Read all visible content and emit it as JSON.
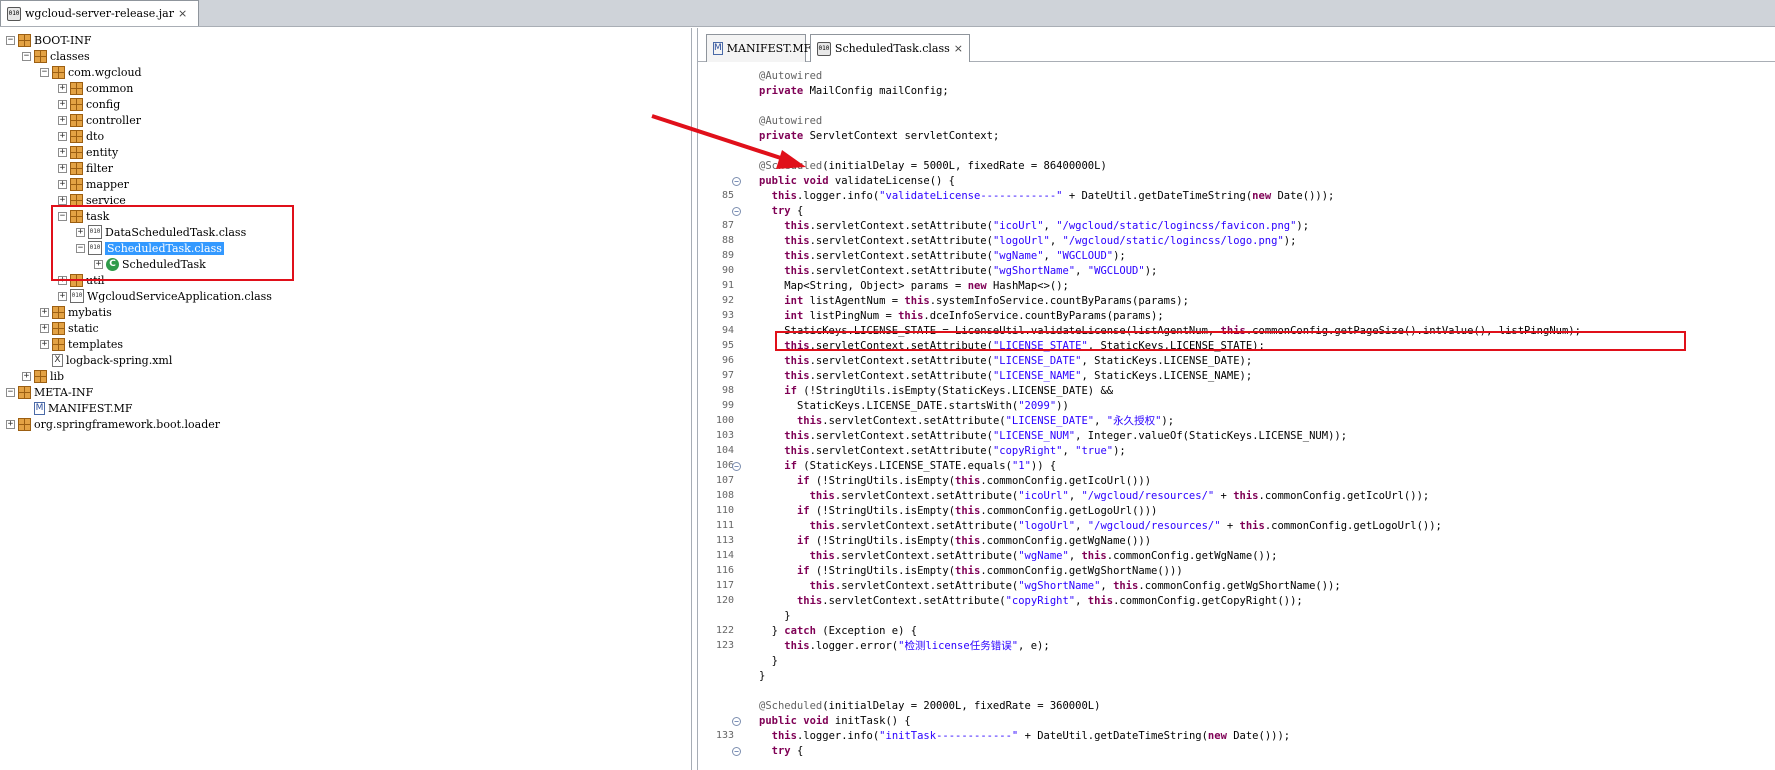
{
  "left_tab": {
    "title": "wgcloud-server-release.jar",
    "close": "⨯"
  },
  "tree": [
    {
      "id": "boot-inf",
      "label": "BOOT-INF",
      "icon": "package-icon",
      "toggle": "−"
    },
    {
      "id": "classes",
      "label": "classes",
      "icon": "package-icon",
      "toggle": "−"
    },
    {
      "id": "com-wgcloud",
      "label": "com.wgcloud",
      "icon": "package-icon",
      "toggle": "−"
    },
    {
      "id": "common",
      "label": "common",
      "icon": "package-icon",
      "toggle": "+"
    },
    {
      "id": "config",
      "label": "config",
      "icon": "package-icon",
      "toggle": "+"
    },
    {
      "id": "controller",
      "label": "controller",
      "icon": "package-icon",
      "toggle": "+"
    },
    {
      "id": "dto",
      "label": "dto",
      "icon": "package-icon",
      "toggle": "+"
    },
    {
      "id": "entity",
      "label": "entity",
      "icon": "package-icon",
      "toggle": "+"
    },
    {
      "id": "filter",
      "label": "filter",
      "icon": "package-icon",
      "toggle": "+"
    },
    {
      "id": "mapper",
      "label": "mapper",
      "icon": "package-icon",
      "toggle": "+"
    },
    {
      "id": "service",
      "label": "service",
      "icon": "package-icon",
      "toggle": "+"
    },
    {
      "id": "task",
      "label": "task",
      "icon": "package-icon",
      "toggle": "−"
    },
    {
      "id": "data-scheduled-task",
      "label": "DataScheduledTask.class",
      "icon": "class-file-icon",
      "toggle": "+"
    },
    {
      "id": "scheduled-task-class",
      "label": "ScheduledTask.class",
      "icon": "class-file-icon",
      "toggle": "−",
      "selected": true
    },
    {
      "id": "scheduled-task",
      "label": "ScheduledTask",
      "icon": "class-icon",
      "toggle": "+"
    },
    {
      "id": "util",
      "label": "util",
      "icon": "package-icon",
      "toggle": "+"
    },
    {
      "id": "wgcloud-service-app",
      "label": "WgcloudServiceApplication.class",
      "icon": "class-file-icon",
      "toggle": "+"
    },
    {
      "id": "mybatis",
      "label": "mybatis",
      "icon": "package-icon",
      "toggle": "+"
    },
    {
      "id": "static",
      "label": "static",
      "icon": "package-icon",
      "toggle": "+"
    },
    {
      "id": "templates",
      "label": "templates",
      "icon": "package-icon",
      "toggle": "+"
    },
    {
      "id": "logback-spring",
      "label": "logback-spring.xml",
      "icon": "xml-file-icon",
      "toggle": ""
    },
    {
      "id": "lib",
      "label": "lib",
      "icon": "package-icon",
      "toggle": "+"
    },
    {
      "id": "meta-inf",
      "label": "META-INF",
      "icon": "package-icon",
      "toggle": "−"
    },
    {
      "id": "manifest-file",
      "label": "MANIFEST.MF",
      "icon": "manifest-file-icon",
      "toggle": ""
    },
    {
      "id": "spring-loader",
      "label": "org.springframework.boot.loader",
      "icon": "package-icon",
      "toggle": "+"
    }
  ],
  "editor_tabs": [
    {
      "title": "MANIFEST.MF",
      "close": "⨯"
    },
    {
      "title": "ScheduledTask.class",
      "close": "⨯",
      "active": true
    }
  ],
  "code_lines": [
    {
      "ln": "",
      "fold": "",
      "code": "@Autowired"
    },
    {
      "ln": "",
      "fold": "",
      "code": "private MailConfig mailConfig;"
    },
    {
      "ln": "",
      "fold": "",
      "code": ""
    },
    {
      "ln": "",
      "fold": "",
      "code": "@Autowired"
    },
    {
      "ln": "",
      "fold": "",
      "code": "private ServletContext servletContext;"
    },
    {
      "ln": "",
      "fold": "",
      "code": ""
    },
    {
      "ln": "",
      "fold": "",
      "code": "@Scheduled(initialDelay = 5000L, fixedRate = 86400000L)"
    },
    {
      "ln": "",
      "fold": "−",
      "code": "public void validateLicense() {"
    },
    {
      "ln": "85",
      "fold": "",
      "code": "  this.logger.info(\"validateLicense------------\" + DateUtil.getDateTimeString(new Date()));"
    },
    {
      "ln": "",
      "fold": "−",
      "code": "  try {"
    },
    {
      "ln": "87",
      "fold": "",
      "code": "    this.servletContext.setAttribute(\"icoUrl\", \"/wgcloud/static/logincss/favicon.png\");"
    },
    {
      "ln": "88",
      "fold": "",
      "code": "    this.servletContext.setAttribute(\"logoUrl\", \"/wgcloud/static/logincss/logo.png\");"
    },
    {
      "ln": "89",
      "fold": "",
      "code": "    this.servletContext.setAttribute(\"wgName\", \"WGCLOUD\");"
    },
    {
      "ln": "90",
      "fold": "",
      "code": "    this.servletContext.setAttribute(\"wgShortName\", \"WGCLOUD\");"
    },
    {
      "ln": "91",
      "fold": "",
      "code": "    Map<String, Object> params = new HashMap<>();"
    },
    {
      "ln": "92",
      "fold": "",
      "code": "    int listAgentNum = this.systemInfoService.countByParams(params);"
    },
    {
      "ln": "93",
      "fold": "",
      "code": "    int listPingNum = this.dceInfoService.countByParams(params);"
    },
    {
      "ln": "94",
      "fold": "",
      "code": "    StaticKeys.LICENSE_STATE = LicenseUtil.validateLicense(listAgentNum, this.commonConfig.getPageSize().intValue(), listPingNum);"
    },
    {
      "ln": "95",
      "fold": "",
      "code": "    this.servletContext.setAttribute(\"LICENSE_STATE\", StaticKeys.LICENSE_STATE);"
    },
    {
      "ln": "96",
      "fold": "",
      "code": "    this.servletContext.setAttribute(\"LICENSE_DATE\", StaticKeys.LICENSE_DATE);"
    },
    {
      "ln": "97",
      "fold": "",
      "code": "    this.servletContext.setAttribute(\"LICENSE_NAME\", StaticKeys.LICENSE_NAME);"
    },
    {
      "ln": "98",
      "fold": "",
      "code": "    if (!StringUtils.isEmpty(StaticKeys.LICENSE_DATE) &&"
    },
    {
      "ln": "99",
      "fold": "",
      "code": "      StaticKeys.LICENSE_DATE.startsWith(\"2099\"))"
    },
    {
      "ln": "100",
      "fold": "",
      "code": "      this.servletContext.setAttribute(\"LICENSE_DATE\", \"永久授权\");"
    },
    {
      "ln": "103",
      "fold": "",
      "code": "    this.servletContext.setAttribute(\"LICENSE_NUM\", Integer.valueOf(StaticKeys.LICENSE_NUM));"
    },
    {
      "ln": "104",
      "fold": "",
      "code": "    this.servletContext.setAttribute(\"copyRight\", \"true\");"
    },
    {
      "ln": "106",
      "fold": "−",
      "code": "    if (StaticKeys.LICENSE_STATE.equals(\"1\")) {"
    },
    {
      "ln": "107",
      "fold": "",
      "code": "      if (!StringUtils.isEmpty(this.commonConfig.getIcoUrl()))"
    },
    {
      "ln": "108",
      "fold": "",
      "code": "        this.servletContext.setAttribute(\"icoUrl\", \"/wgcloud/resources/\" + this.commonConfig.getIcoUrl());"
    },
    {
      "ln": "110",
      "fold": "",
      "code": "      if (!StringUtils.isEmpty(this.commonConfig.getLogoUrl()))"
    },
    {
      "ln": "111",
      "fold": "",
      "code": "        this.servletContext.setAttribute(\"logoUrl\", \"/wgcloud/resources/\" + this.commonConfig.getLogoUrl());"
    },
    {
      "ln": "113",
      "fold": "",
      "code": "      if (!StringUtils.isEmpty(this.commonConfig.getWgName()))"
    },
    {
      "ln": "114",
      "fold": "",
      "code": "        this.servletContext.setAttribute(\"wgName\", this.commonConfig.getWgName());"
    },
    {
      "ln": "116",
      "fold": "",
      "code": "      if (!StringUtils.isEmpty(this.commonConfig.getWgShortName()))"
    },
    {
      "ln": "117",
      "fold": "",
      "code": "        this.servletContext.setAttribute(\"wgShortName\", this.commonConfig.getWgShortName());"
    },
    {
      "ln": "120",
      "fold": "",
      "code": "      this.servletContext.setAttribute(\"copyRight\", this.commonConfig.getCopyRight());"
    },
    {
      "ln": "",
      "fold": "",
      "code": "    }"
    },
    {
      "ln": "122",
      "fold": "",
      "code": "  } catch (Exception e) {"
    },
    {
      "ln": "123",
      "fold": "",
      "code": "    this.logger.error(\"检测license任务错误\", e);"
    },
    {
      "ln": "",
      "fold": "",
      "code": "  }"
    },
    {
      "ln": "",
      "fold": "",
      "code": "}"
    },
    {
      "ln": "",
      "fold": "",
      "code": ""
    },
    {
      "ln": "",
      "fold": "",
      "code": "@Scheduled(initialDelay = 20000L, fixedRate = 360000L)"
    },
    {
      "ln": "",
      "fold": "−",
      "code": "public void initTask() {"
    },
    {
      "ln": "133",
      "fold": "",
      "code": "  this.logger.info(\"initTask------------\" + DateUtil.getDateTimeString(new Date()));"
    },
    {
      "ln": "",
      "fold": "−",
      "code": "  try {"
    }
  ],
  "colors": {
    "highlight_box": "#e0101a",
    "selection": "#3399ff",
    "keyword": "#7f0055",
    "string": "#2a00ff",
    "annotation": "#646464"
  }
}
